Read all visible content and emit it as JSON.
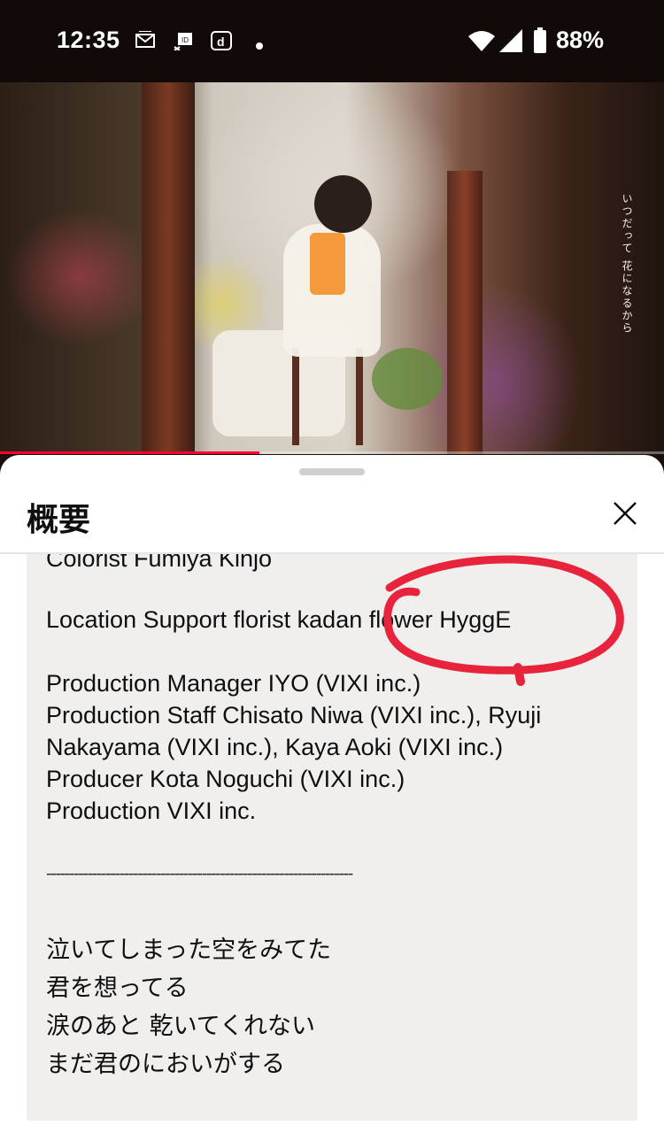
{
  "status_bar": {
    "time": "12:35",
    "battery_percent": "88%",
    "icons": [
      "gmail-icon",
      "notification-icon",
      "d-app-icon",
      "dot-icon",
      "wifi-icon",
      "signal-icon",
      "battery-icon"
    ]
  },
  "video": {
    "overlay_caption": "いつだって 花になるから",
    "progress_fraction": 0.39,
    "progress_color": "#ff0033"
  },
  "sheet": {
    "title": "概要",
    "close_icon": "close-icon",
    "description_lines": [
      "Colorist Fumiya Kinjo",
      "Location Support florist kadan flower HyggE",
      "Production Manager IYO (VIXI inc.)",
      "Production Staff Chisato Niwa (VIXI inc.), Ryuji",
      "Nakayama (VIXI inc.), Kaya Aoki (VIXI inc.)",
      "Producer Kota Noguchi (VIXI inc.)",
      "Production VIXI inc.",
      "-------------------------------------------------------------------",
      "泣いてしまった空をみてた",
      "君を想ってる",
      "涙のあと 乾いてくれない",
      "まだ君のにおいがする"
    ]
  },
  "colors": {
    "annotation_red": "#e8243c",
    "sheet_bg": "#ffffff",
    "description_bg": "#f0efee"
  }
}
